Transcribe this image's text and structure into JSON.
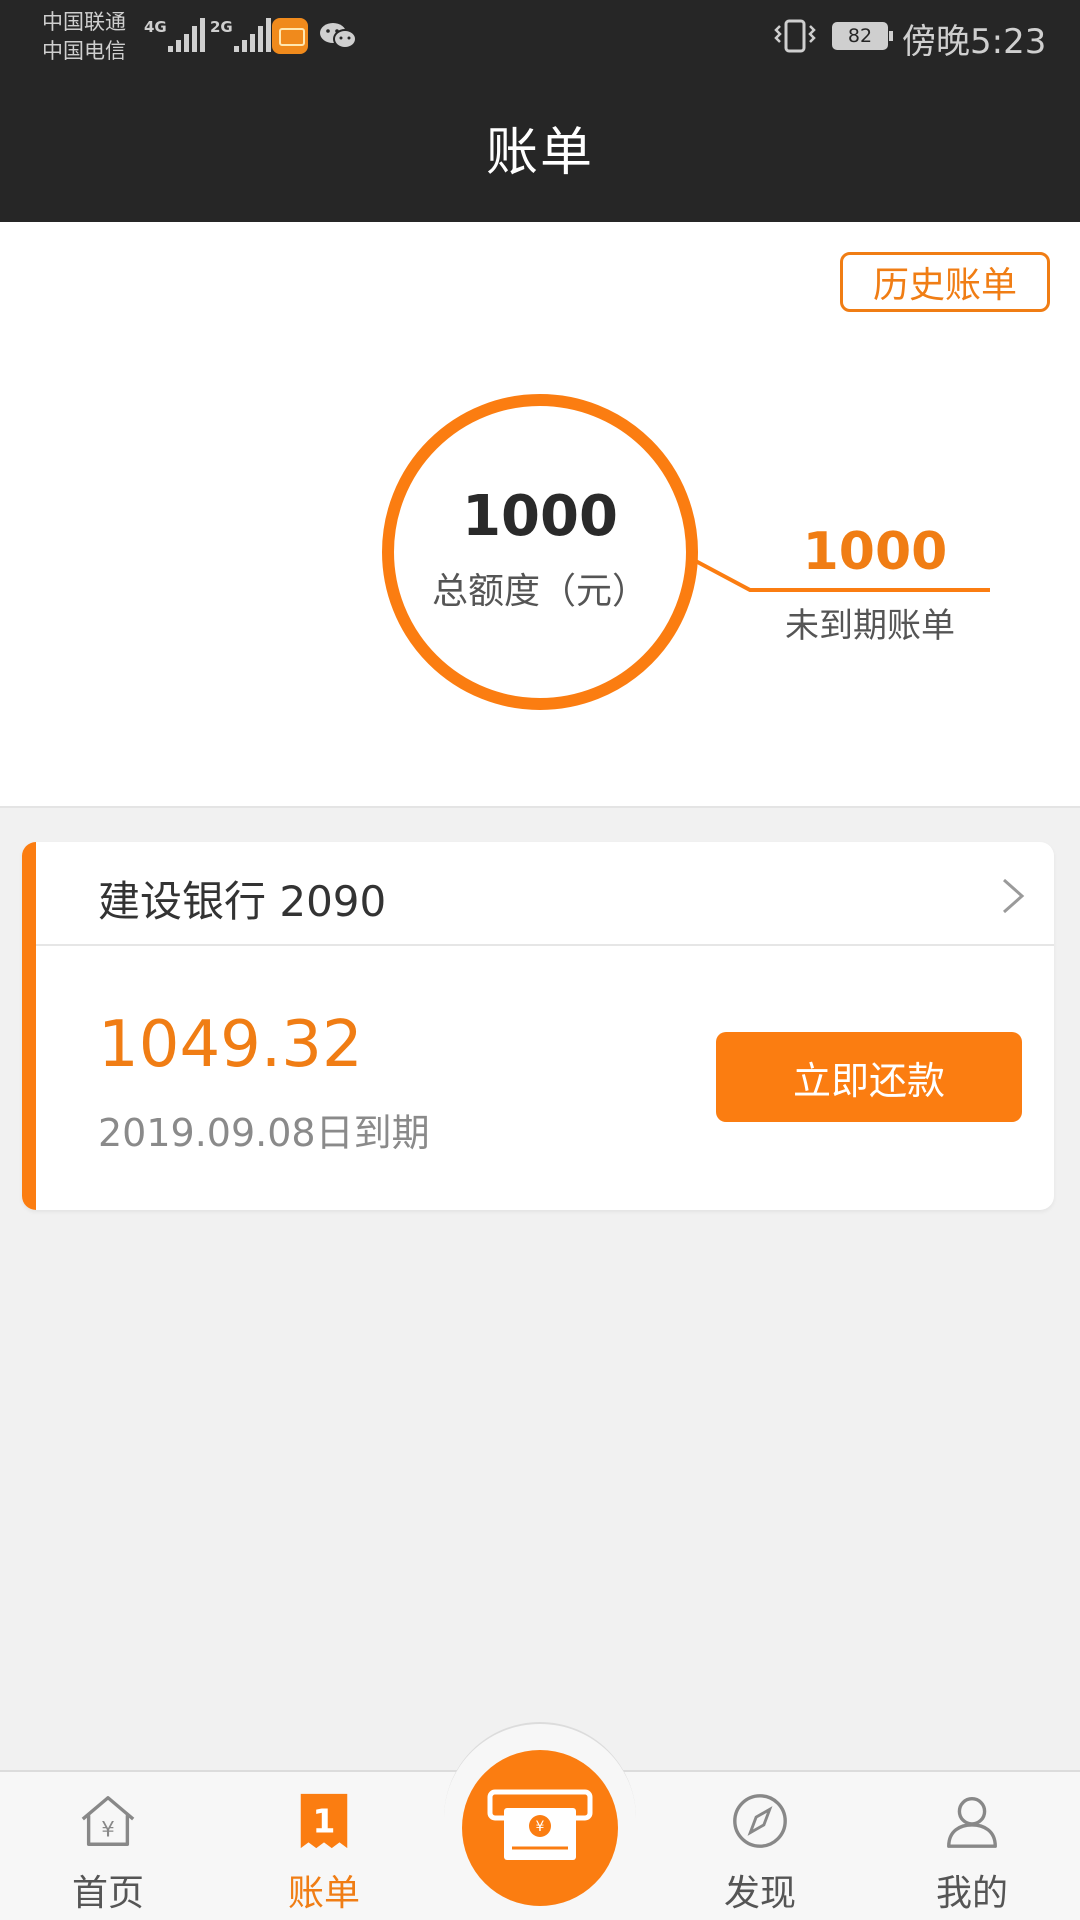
{
  "status_bar": {
    "carrier_1": "中国联通",
    "carrier_2": "中国电信",
    "network_1": "4G",
    "network_2": "2G",
    "battery": "82",
    "time": "傍晚5:23"
  },
  "header": {
    "title": "账单"
  },
  "summary": {
    "history_button": "历史账单",
    "total_amount": "1000",
    "total_label": "总额度（元）",
    "due_amount": "1000",
    "due_label": "未到期账单",
    "accent_color": "#fb7d11"
  },
  "bill": {
    "bank": "建设银行 2090",
    "amount": "1049.32",
    "due_date": "2019.09.08日到期",
    "repay_button": "立即还款"
  },
  "bottom_nav": {
    "items": [
      {
        "label": "首页",
        "icon": "home-yen-icon",
        "active": false
      },
      {
        "label": "账单",
        "icon": "bill-icon",
        "active": true
      },
      {
        "label": "",
        "icon": "cash-machine-icon",
        "active": false
      },
      {
        "label": "发现",
        "icon": "compass-icon",
        "active": false
      },
      {
        "label": "我的",
        "icon": "user-icon",
        "active": false
      }
    ]
  }
}
